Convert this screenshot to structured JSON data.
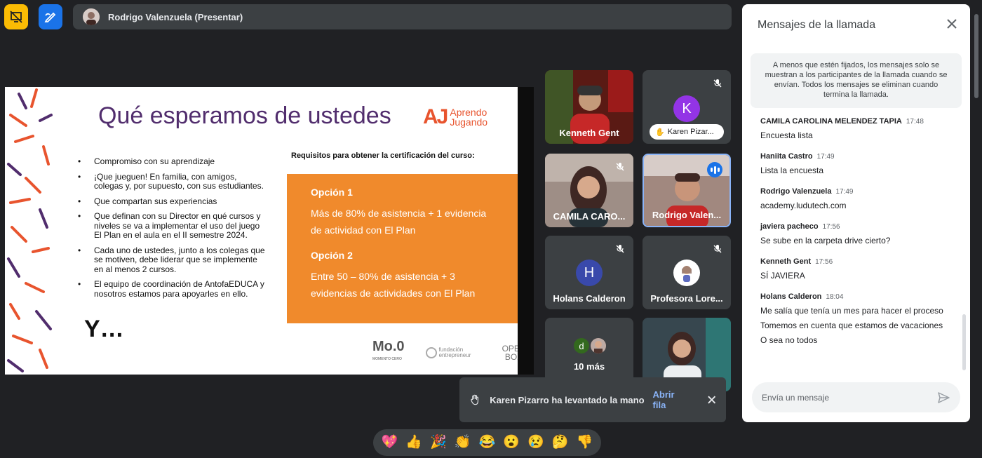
{
  "top_bar": {
    "presenter_name": "Rodrigo Valenzuela (Presentar)",
    "icons": [
      "presentation-off-icon",
      "annotate-icon"
    ]
  },
  "slide": {
    "title": "Qué esperamos de ustedes",
    "logo_aj": "AJ",
    "logo_line1": "Aprendo",
    "logo_line2": "Jugando",
    "bullets": [
      "Compromiso con su aprendizaje",
      "¡Que jueguen! En familia, con amigos, colegas y, por supuesto, con sus estudiantes.",
      "Que compartan sus experiencias",
      "Que definan con su Director en qué cursos y niveles se va a implementar el uso del juego El Plan en el aula en el II semestre 2024.",
      "Cada uno de ustedes, junto a los colegas que se motiven, debe liderar que se implemente en al menos 2 cursos.",
      "El equipo de coordinación de AntofaEDUCA y nosotros estamos para apoyarles en ello."
    ],
    "closing": "Y…",
    "requirements_title": "Requisitos para obtener la certificación del curso:",
    "option1_title": "Opción 1",
    "option1_desc": "Más de 80% de asistencia + 1 evidencia de actividad con El Plan",
    "option2_title": "Opción 2",
    "option2_desc": "Entre 50 – 80% de asistencia + 3 evidencias de actividades con El Plan",
    "footer_mo0": "Mo.0",
    "footer_mo0_sub": "MOMENTO CERO",
    "footer_fund": "fundación entrepreneur",
    "footer_openbox_1": "OPEN",
    "footer_openbox_2": "BOX"
  },
  "tiles": {
    "kenneth": "Kenneth Gent",
    "karen": "Karen Pizar...",
    "karen_initial": "K",
    "camila": "CAMILA CARO...",
    "rodrigo": "Rodrigo Valen...",
    "holans": "Holans Calderon",
    "holans_initial": "H",
    "profesora": "Profesora Lore...",
    "more_initial": "d",
    "more": "10 más"
  },
  "toast": {
    "message": "Karen Pizarro ha levantado la mano",
    "action": "Abrir fila"
  },
  "reactions": [
    "💖",
    "👍",
    "🎉",
    "👏",
    "😂",
    "😮",
    "😢",
    "🤔",
    "👎"
  ],
  "chat": {
    "title": "Mensajes de la llamada",
    "notice": "A menos que estén fijados, los mensajes solo se muestran a los participantes de la llamada cuando se envían. Todos los mensajes se eliminan cuando termina la llamada.",
    "messages": [
      {
        "sender": "CAMILA CAROLINA MELENDEZ TAPIA",
        "time": "17:48",
        "lines": [
          "Encuesta lista"
        ]
      },
      {
        "sender": "Haniita Castro",
        "time": "17:49",
        "lines": [
          "Lista la encuesta"
        ]
      },
      {
        "sender": "Rodrigo Valenzuela",
        "time": "17:49",
        "lines": [
          "academy.ludutech.com"
        ]
      },
      {
        "sender": "javiera pacheco",
        "time": "17:56",
        "lines": [
          "Se sube en la carpeta drive cierto?"
        ]
      },
      {
        "sender": "Kenneth Gent",
        "time": "17:56",
        "lines": [
          "SÍ JAVIERA"
        ]
      },
      {
        "sender": "Holans Calderon",
        "time": "18:04",
        "lines": [
          "Me salía que tenía un mes para hacer el proceso",
          "Tomemos en cuenta que estamos de vacaciones",
          "O sea no todos"
        ]
      }
    ],
    "input_placeholder": "Envía un mensaje"
  },
  "colors": {
    "background": "#202124",
    "accent_blue": "#1a73e8",
    "slide_orange": "#f08a2c",
    "slide_purple": "#512d6d"
  }
}
